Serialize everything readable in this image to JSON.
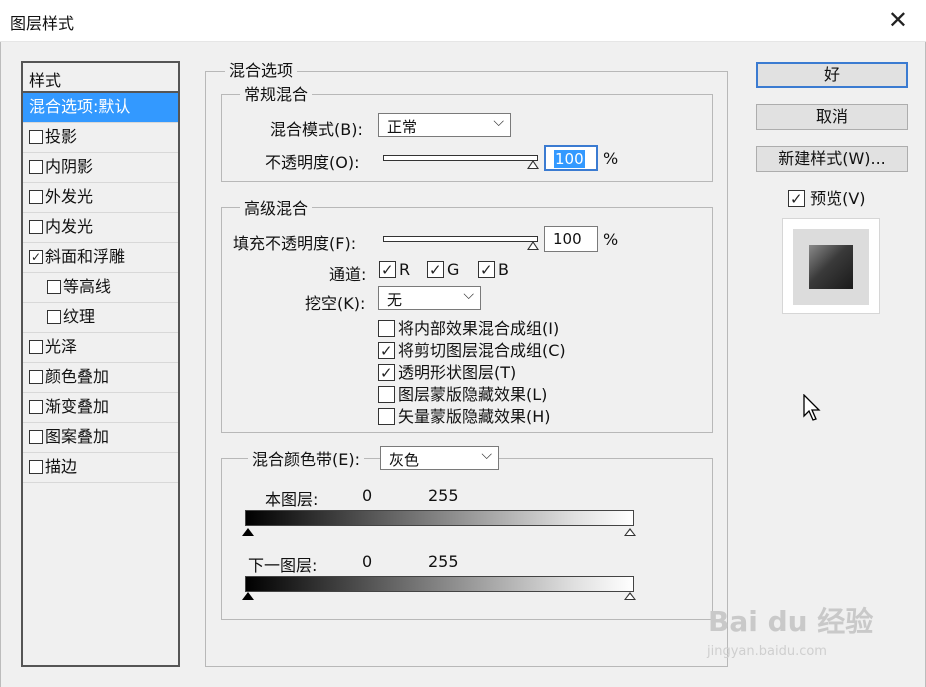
{
  "window": {
    "title": "图层样式"
  },
  "styles": {
    "header": "样式",
    "items": [
      {
        "label": "混合选项:默认",
        "checkbox": null,
        "selected": true,
        "sub": false
      },
      {
        "label": "投影",
        "checkbox": false,
        "selected": false,
        "sub": false
      },
      {
        "label": "内阴影",
        "checkbox": false,
        "selected": false,
        "sub": false
      },
      {
        "label": "外发光",
        "checkbox": false,
        "selected": false,
        "sub": false
      },
      {
        "label": "内发光",
        "checkbox": false,
        "selected": false,
        "sub": false
      },
      {
        "label": "斜面和浮雕",
        "checkbox": true,
        "selected": false,
        "sub": false
      },
      {
        "label": "等高线",
        "checkbox": false,
        "selected": false,
        "sub": true
      },
      {
        "label": "纹理",
        "checkbox": false,
        "selected": false,
        "sub": true
      },
      {
        "label": "光泽",
        "checkbox": false,
        "selected": false,
        "sub": false
      },
      {
        "label": "颜色叠加",
        "checkbox": false,
        "selected": false,
        "sub": false
      },
      {
        "label": "渐变叠加",
        "checkbox": false,
        "selected": false,
        "sub": false
      },
      {
        "label": "图案叠加",
        "checkbox": false,
        "selected": false,
        "sub": false
      },
      {
        "label": "描边",
        "checkbox": false,
        "selected": false,
        "sub": false
      }
    ]
  },
  "blending_options": {
    "title": "混合选项",
    "general": {
      "title": "常规混合",
      "mode_label": "混合模式(B):",
      "mode_value": "正常",
      "opacity_label": "不透明度(O):",
      "opacity_value": "100",
      "percent": "%"
    },
    "advanced": {
      "title": "高级混合",
      "fill_label": "填充不透明度(F):",
      "fill_value": "100",
      "percent": "%",
      "channels_label": "通道:",
      "channels": [
        {
          "label": "R",
          "checked": true
        },
        {
          "label": "G",
          "checked": true
        },
        {
          "label": "B",
          "checked": true
        }
      ],
      "knockout_label": "挖空(K):",
      "knockout_value": "无",
      "options": [
        {
          "label": "将内部效果混合成组(I)",
          "checked": false
        },
        {
          "label": "将剪切图层混合成组(C)",
          "checked": true
        },
        {
          "label": "透明形状图层(T)",
          "checked": true
        },
        {
          "label": "图层蒙版隐藏效果(L)",
          "checked": false
        },
        {
          "label": "矢量蒙版隐藏效果(H)",
          "checked": false
        }
      ]
    },
    "blend_if": {
      "label": "混合颜色带(E):",
      "value": "灰色",
      "this_layer": {
        "label": "本图层:",
        "min": "0",
        "max": "255"
      },
      "underlying": {
        "label": "下一图层:",
        "min": "0",
        "max": "255"
      }
    }
  },
  "buttons": {
    "ok": "好",
    "cancel": "取消",
    "new_style": "新建样式(W)...",
    "preview_label": "预览(V)",
    "preview_checked": true
  },
  "watermark": {
    "main": "Bai du 经验",
    "sub": "jingyan.baidu.com"
  }
}
